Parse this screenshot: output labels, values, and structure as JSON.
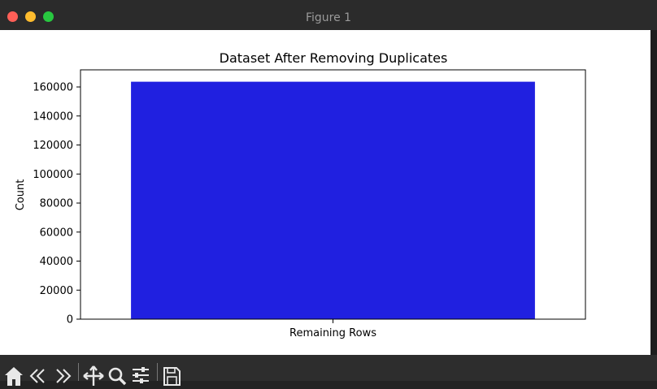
{
  "window": {
    "title": "Figure 1",
    "buttons": {
      "close_color": "#ff5f57",
      "minimize_color": "#febc2e",
      "zoom_color": "#28c840"
    }
  },
  "toolbar": {
    "icons": [
      "home-icon",
      "back-icon",
      "forward-icon",
      "pan-icon",
      "zoom-icon",
      "configure-subplots-icon",
      "save-icon"
    ]
  },
  "colors": {
    "bar": "#2020e0",
    "background": "#ffffff",
    "chrome": "#232323"
  },
  "chart_data": {
    "type": "bar",
    "title": "Dataset After Removing Duplicates",
    "xlabel": "",
    "ylabel": "Count",
    "categories": [
      "Remaining Rows"
    ],
    "values": [
      163600
    ],
    "ylim": [
      0,
      171780
    ],
    "yticks": [
      0,
      20000,
      40000,
      60000,
      80000,
      100000,
      120000,
      140000,
      160000
    ],
    "grid": false
  }
}
